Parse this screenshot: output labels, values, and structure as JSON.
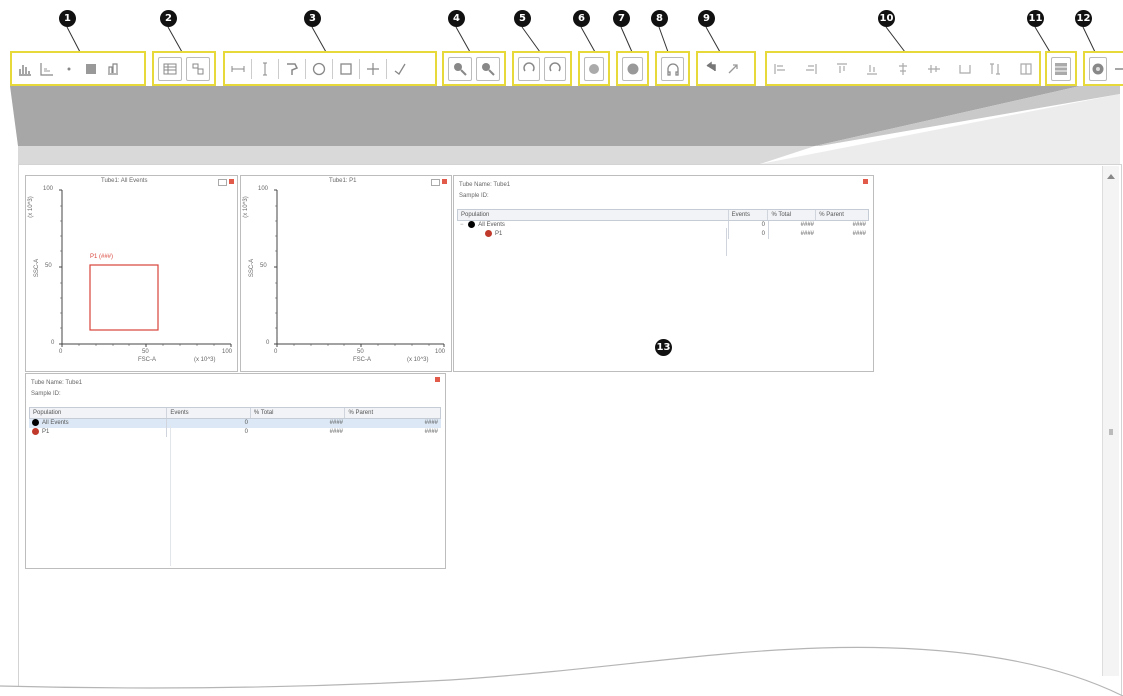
{
  "callouts": [
    "1",
    "2",
    "3",
    "4",
    "5",
    "6",
    "7",
    "8",
    "9",
    "10",
    "11",
    "12",
    "13"
  ],
  "colors": {
    "callout_bg": "#111111",
    "highlight": "#e8d93a",
    "gate": "#d9443a",
    "pop_all_events": "#000000",
    "pop_p1": "#c0392b",
    "close_button": "#e25a4a"
  },
  "toolbar": {
    "groups": [
      {
        "icons": [
          "histogram-icon",
          "bivariate-plot-icon",
          "dot-plot-icon",
          "density-plot-icon",
          "population-hierarchy-icon"
        ]
      },
      {
        "icons": [
          "statistics-view-icon",
          "layout-icon"
        ]
      },
      {
        "icons": [
          "interval-gate-icon",
          "bisector-gate-icon",
          "polygon-gate-icon",
          "ellipse-gate-icon",
          "rectangle-gate-icon",
          "quad-gate-icon",
          "snap-to-gate-icon"
        ]
      },
      {
        "icons": [
          "zoom-in-icon",
          "zoom-out-icon"
        ]
      },
      {
        "icons": [
          "undo-icon",
          "redo-icon"
        ]
      },
      {
        "icons": [
          "print-icon"
        ]
      },
      {
        "icons": [
          "record-icon"
        ]
      },
      {
        "icons": [
          "headphones-icon"
        ]
      },
      {
        "icons": [
          "back-icon",
          "forward-icon"
        ]
      },
      {
        "icons": [
          "align-left-icon",
          "align-right-icon",
          "align-top-icon",
          "align-bottom-icon",
          "align-center-icon",
          "align-middle-icon",
          "same-width-icon",
          "same-height-icon",
          "same-size-icon"
        ]
      },
      {
        "icons": [
          "grid-view-icon"
        ]
      },
      {
        "icons": [
          "color-icon",
          "more-icon"
        ]
      }
    ]
  },
  "plot1": {
    "title": "Tube1: All Events",
    "gate_label": "P1 (###)",
    "x_ticks": [
      "0",
      "50",
      "100"
    ],
    "x_label": "FSC-A",
    "x_unit": "(x 10^3)",
    "y_ticks": [
      "0",
      "50",
      "100"
    ],
    "y_label": "SSC-A",
    "y_unit": "(x 10^3)"
  },
  "plot2": {
    "title": "Tube1: P1",
    "x_ticks": [
      "0",
      "50",
      "100"
    ],
    "x_label": "FSC-A",
    "x_unit": "(x 10^3)",
    "y_ticks": [
      "0",
      "50",
      "100"
    ],
    "y_label": "SSC-A",
    "y_unit": "(x 10^3)"
  },
  "stats_top": {
    "tube_name": "Tube Name: Tube1",
    "sample_id": "Sample ID:",
    "columns": [
      "Population",
      "Events",
      "% Total",
      "% Parent"
    ],
    "rows": [
      {
        "name": "All Events",
        "events": "0",
        "total": "####",
        "parent": "####"
      },
      {
        "name": "P1",
        "events": "0",
        "total": "####",
        "parent": "####"
      }
    ]
  },
  "stats_bottom": {
    "tube_name": "Tube Name: Tube1",
    "sample_id": "Sample ID:",
    "columns": [
      "Population",
      "Events",
      "% Total",
      "% Parent"
    ],
    "rows": [
      {
        "name": "All Events",
        "events": "0",
        "total": "####",
        "parent": "####"
      },
      {
        "name": "P1",
        "events": "0",
        "total": "####",
        "parent": "####"
      }
    ]
  }
}
